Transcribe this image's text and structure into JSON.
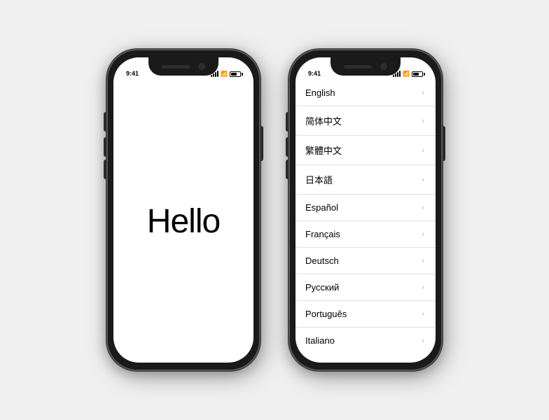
{
  "phones": [
    {
      "id": "phone-hello",
      "statusBar": {
        "time": "9:41",
        "signalBars": [
          3,
          5,
          7,
          10,
          12
        ],
        "wifi": "wifi",
        "battery": 70
      },
      "content": {
        "type": "hello",
        "text": "Hello"
      }
    },
    {
      "id": "phone-languages",
      "statusBar": {
        "time": "9:41",
        "signalBars": [
          3,
          5,
          7,
          10,
          12
        ],
        "wifi": "wifi",
        "battery": 70
      },
      "content": {
        "type": "language-list",
        "languages": [
          "English",
          "简体中文",
          "繁體中文",
          "日本語",
          "Español",
          "Français",
          "Deutsch",
          "Русский",
          "Português",
          "Italiano"
        ]
      }
    }
  ]
}
